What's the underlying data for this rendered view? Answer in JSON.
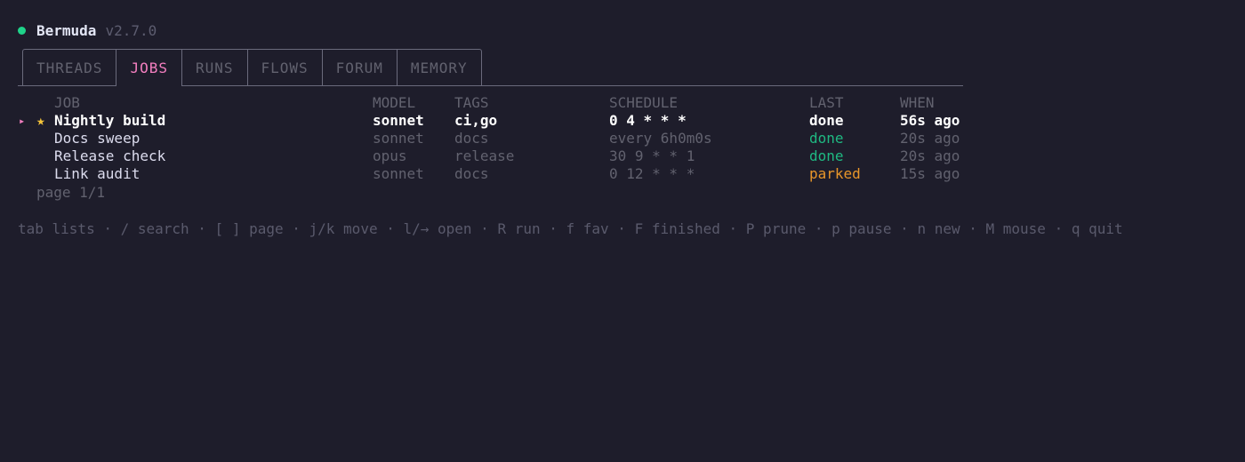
{
  "app": {
    "name": "Bermuda",
    "version": "v2.7.0",
    "status_color": "#1fd38a"
  },
  "tabs": [
    {
      "label": "THREADS",
      "active": false
    },
    {
      "label": "JOBS",
      "active": true
    },
    {
      "label": "RUNS",
      "active": false
    },
    {
      "label": "FLOWS",
      "active": false
    },
    {
      "label": "FORUM",
      "active": false
    },
    {
      "label": "MEMORY",
      "active": false
    }
  ],
  "table": {
    "columns": {
      "job": "JOB",
      "model": "MODEL",
      "tags": "TAGS",
      "schedule": "SCHEDULE",
      "last": "LAST",
      "when": "WHEN"
    },
    "rows": [
      {
        "selected": true,
        "favorite": true,
        "name": "Nightly build",
        "model": "sonnet",
        "tags": "ci,go",
        "schedule": "0 4 * * *",
        "last": "done",
        "when": "56s ago"
      },
      {
        "selected": false,
        "favorite": false,
        "name": "Docs sweep",
        "model": "sonnet",
        "tags": "docs",
        "schedule": "every 6h0m0s",
        "last": "done",
        "when": "20s ago"
      },
      {
        "selected": false,
        "favorite": false,
        "name": "Release check",
        "model": "opus",
        "tags": "release",
        "schedule": "30 9 * * 1",
        "last": "done",
        "when": "20s ago"
      },
      {
        "selected": false,
        "favorite": false,
        "name": "Link audit",
        "model": "sonnet",
        "tags": "docs",
        "schedule": "0 12 * * *",
        "last": "parked",
        "when": "15s ago"
      }
    ],
    "selection_marker": "▸",
    "favorite_marker": "★",
    "pagination": "page 1/1"
  },
  "footer": {
    "help": "tab lists · / search · [ ] page · j/k move · l/→ open · R run · f fav · F finished · P prune · p pause · n new · M mouse · q quit"
  },
  "colors": {
    "background": "#1e1d2b",
    "accent": "#f47fc0",
    "done": "#1fb982",
    "parked": "#e8962a",
    "favorite": "#f5c43a"
  }
}
